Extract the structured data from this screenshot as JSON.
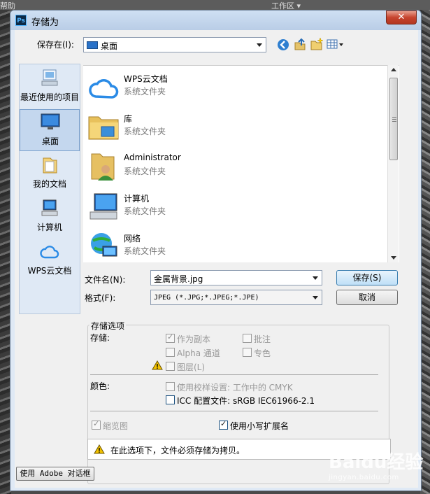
{
  "background": {
    "strip_left": "帮助",
    "strip_right": "工作区 ▾"
  },
  "dialog": {
    "title": "存储为",
    "close": "✕",
    "app_icon": "Ps"
  },
  "location": {
    "label": "保存在(I):",
    "value": "桌面"
  },
  "toolbar": {
    "icons": [
      "back-icon",
      "up-folder-icon",
      "new-folder-icon",
      "view-menu-icon"
    ]
  },
  "places": [
    {
      "label": "最近使用的项目",
      "icon": "recent-items-icon"
    },
    {
      "label": "桌面",
      "icon": "desktop-icon",
      "selected": true
    },
    {
      "label": "我的文档",
      "icon": "documents-icon"
    },
    {
      "label": "计算机",
      "icon": "computer-icon"
    },
    {
      "label": "WPS云文档",
      "icon": "wps-cloud-icon"
    }
  ],
  "files": [
    {
      "name": "WPS云文档",
      "kind": "系统文件夹",
      "icon": "wps-cloud-icon"
    },
    {
      "name": "库",
      "kind": "系统文件夹",
      "icon": "library-icon"
    },
    {
      "name": "Administrator",
      "kind": "系统文件夹",
      "icon": "user-folder-icon"
    },
    {
      "name": "计算机",
      "kind": "系统文件夹",
      "icon": "computer-icon"
    },
    {
      "name": "网络",
      "kind": "系统文件夹",
      "icon": "network-icon"
    }
  ],
  "filename": {
    "label": "文件名(N):",
    "value": "金属背景.jpg"
  },
  "format": {
    "label": "格式(F):",
    "value": "JPEG (*.JPG;*.JPEG;*.JPE)"
  },
  "buttons": {
    "save": "保存(S)",
    "cancel": "取消",
    "use_adobe": "使用 Adobe 对话框"
  },
  "options": {
    "group_title": "存储选项",
    "storage_label": "存储:",
    "as_copy": "作为副本",
    "annotations": "批注",
    "alpha": "Alpha 通道",
    "spot": "专色",
    "layers": "图层(L)",
    "color_label": "颜色:",
    "proof": "使用校样设置: 工作中的 CMYK",
    "icc": "ICC 配置文件: sRGB IEC61966-2.1",
    "thumbnail": "缩览图",
    "lowercase_ext": "使用小写扩展名",
    "notice": "在此选项下，文件必须存储为拷贝。"
  },
  "watermark": {
    "brand": "Baidu经验",
    "url": "jingyan.baidu.com"
  },
  "colors": {
    "accent": "#3c7fb1",
    "titlebar": "#b9cde6",
    "close": "#c7442e",
    "warning": "#f2c200"
  }
}
